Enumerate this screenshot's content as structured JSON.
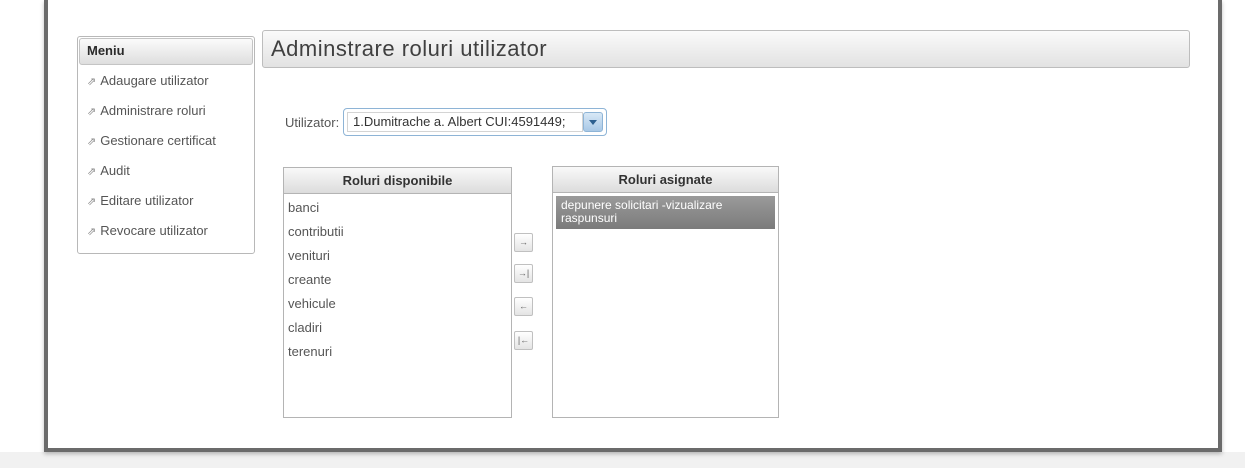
{
  "menu": {
    "header": "Meniu",
    "items": [
      {
        "label": "Adaugare utilizator"
      },
      {
        "label": "Administrare roluri"
      },
      {
        "label": "Gestionare certificat"
      },
      {
        "label": "Audit"
      },
      {
        "label": "Editare utilizator"
      },
      {
        "label": "Revocare utilizator"
      }
    ],
    "item_icon": "external-link-icon"
  },
  "main": {
    "title": "Adminstrare roluri utilizator",
    "user": {
      "label": "Utilizator:",
      "value": "1.Dumitrache a. Albert CUI:4591449;"
    },
    "available": {
      "title": "Roluri disponibile",
      "options": [
        "banci",
        "contributii",
        "venituri",
        "creante",
        "vehicule",
        "cladiri",
        "terenuri"
      ]
    },
    "assigned": {
      "title": "Roluri asignate",
      "options": [
        "depunere solicitari -vizualizare raspunsuri"
      ]
    },
    "buttons": {
      "move_right": "→",
      "move_all_right": "→|",
      "move_left": "←",
      "move_all_left": "|←"
    }
  },
  "colors": {
    "frame": "#6b6b6b",
    "selection": "#888888",
    "dropdown_accent": "#8eb4d6"
  }
}
